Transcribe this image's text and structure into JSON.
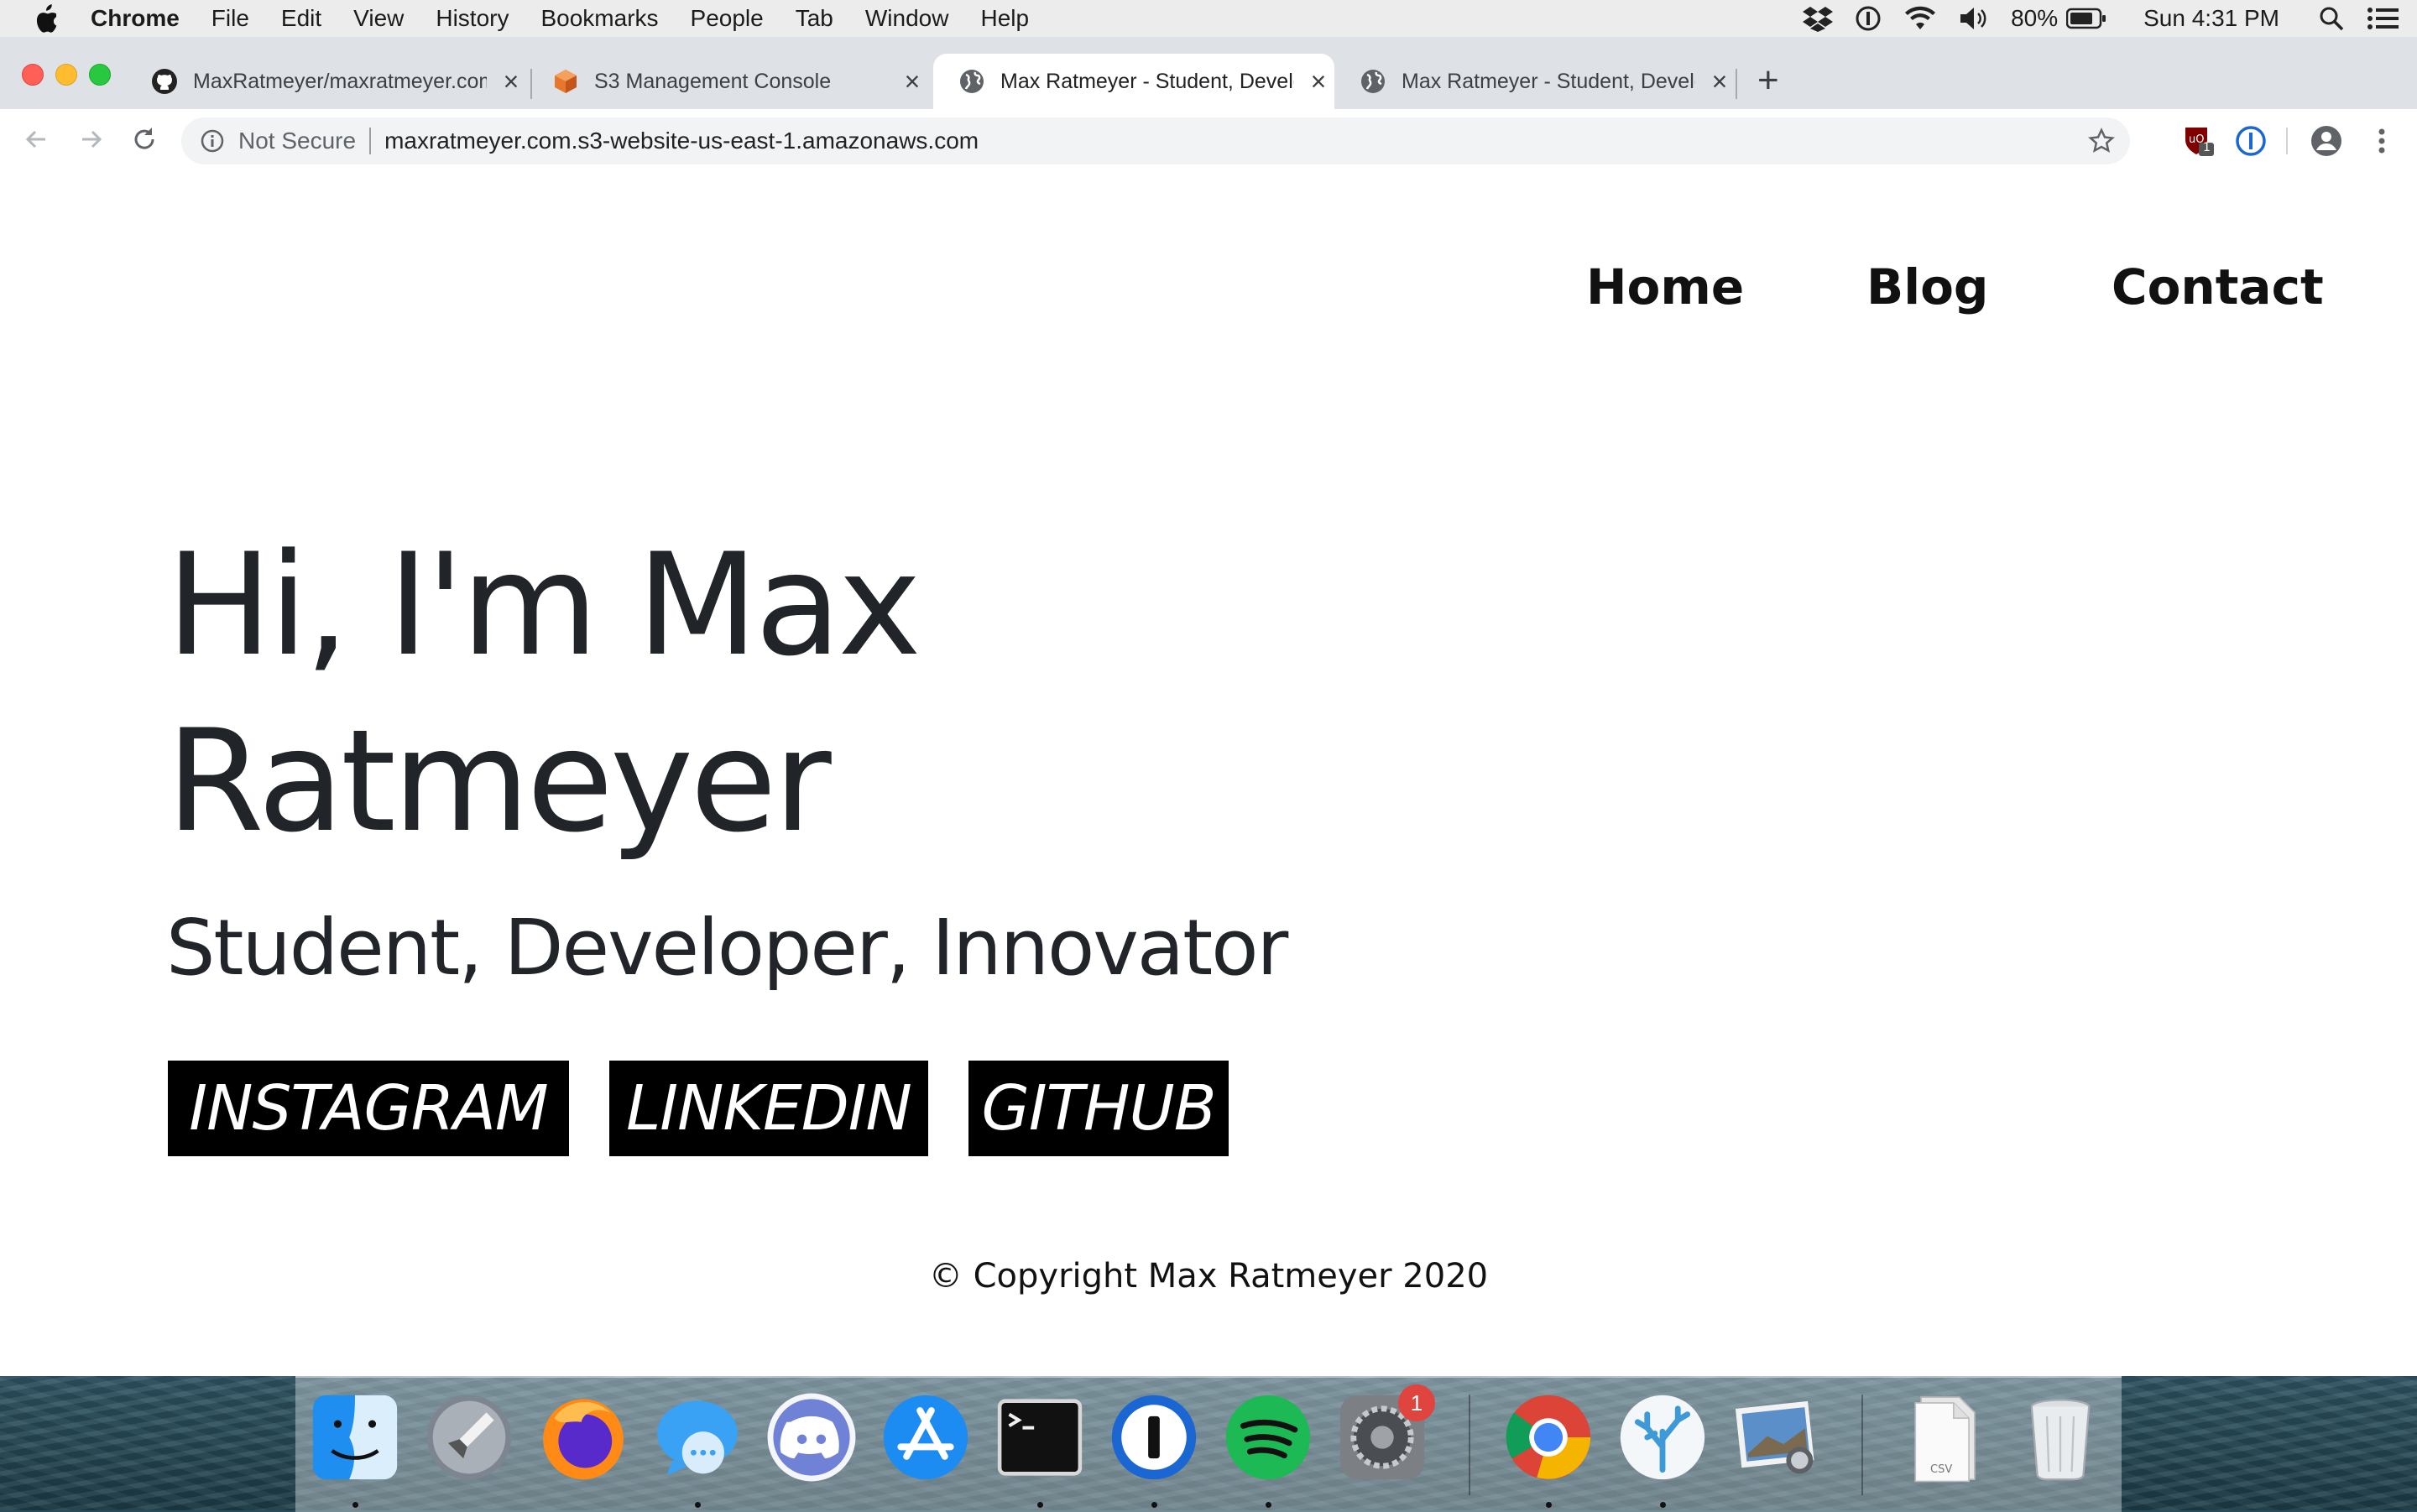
{
  "menubar": {
    "app_name": "Chrome",
    "items": [
      "File",
      "Edit",
      "View",
      "History",
      "Bookmarks",
      "People",
      "Tab",
      "Window",
      "Help"
    ],
    "battery": "80%",
    "clock": "Sun 4:31 PM"
  },
  "tabs": [
    {
      "title": "MaxRatmeyer/maxratmeyer.com",
      "icon": "github-icon"
    },
    {
      "title": "S3 Management Console",
      "icon": "aws-s3-icon"
    },
    {
      "title": "Max Ratmeyer - Student, Developer",
      "icon": "globe-icon",
      "active": true
    },
    {
      "title": "Max Ratmeyer - Student, Developer",
      "icon": "globe-icon"
    }
  ],
  "toolbar": {
    "security_label": "Not Secure",
    "url": "maxratmeyer.com.s3-website-us-east-1.amazonaws.com",
    "extension_badge": "1"
  },
  "site": {
    "nav": [
      "Home",
      "Blog",
      "Contact"
    ],
    "hero_title": "Hi, I'm Max Ratmeyer",
    "hero_subtitle": "Student, Developer, Innovator",
    "social_links": [
      "INSTAGRAM",
      "LINKEDIN",
      "GITHUB"
    ],
    "copyright": "© Copyright Max Ratmeyer 2020"
  },
  "dock": {
    "apps": [
      "finder-icon",
      "launchpad-icon",
      "firefox-icon",
      "messages-icon",
      "discord-icon",
      "app-store-icon",
      "terminal-icon",
      "1password-icon",
      "spotify-icon",
      "system-preferences-icon",
      "chrome-icon",
      "coral-app-icon",
      "preview-icon",
      "downloads-stack-icon",
      "trash-icon"
    ],
    "system_preferences_badge": "1",
    "file_label": "CSV"
  },
  "colors": {
    "close": "#ff5f57",
    "minimize": "#febc2e",
    "zoom": "#28c840",
    "spotify": "#1db954",
    "badge": "#e0443e"
  }
}
